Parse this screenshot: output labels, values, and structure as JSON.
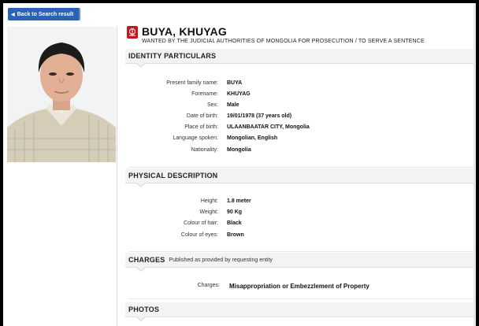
{
  "nav": {
    "back_label": "Back to Search result"
  },
  "person": {
    "name": "BUYA, KHUYAG",
    "wanted_line": "WANTED BY THE JUDICIAL AUTHORITIES OF MONGOLIA FOR PROSECUTION / TO SERVE A SENTENCE"
  },
  "identity": {
    "title": "IDENTITY PARTICULARS",
    "fields": [
      {
        "label": "Present family name:",
        "value": "BUYA"
      },
      {
        "label": "Forename:",
        "value": "KHUYAG"
      },
      {
        "label": "Sex:",
        "value": "Male"
      },
      {
        "label": "Date of birth:",
        "value": "19/01/1978 (37 years old)"
      },
      {
        "label": "Place of birth:",
        "value": "ULAANBAATAR CITY, Mongolia"
      },
      {
        "label": "Language spoken:",
        "value": "Mongolian, English"
      },
      {
        "label": "Nationality:",
        "value": "Mongolia"
      }
    ]
  },
  "physical": {
    "title": "PHYSICAL DESCRIPTION",
    "fields": [
      {
        "label": "Height:",
        "value": "1.8 meter"
      },
      {
        "label": "Weight:",
        "value": "90 Kg"
      },
      {
        "label": "Colour of hair:",
        "value": "Black"
      },
      {
        "label": "Colour of eyes:",
        "value": "Brown"
      }
    ]
  },
  "charges": {
    "title": "CHARGES",
    "note": "Published as provided by requesting entity",
    "label": "Charges:",
    "value": "Misappropriation or Embezzlement of Property"
  },
  "photos": {
    "title": "PHOTOS"
  },
  "colors": {
    "button_blue": "#2a62b4",
    "logo_red": "#c4161c"
  }
}
